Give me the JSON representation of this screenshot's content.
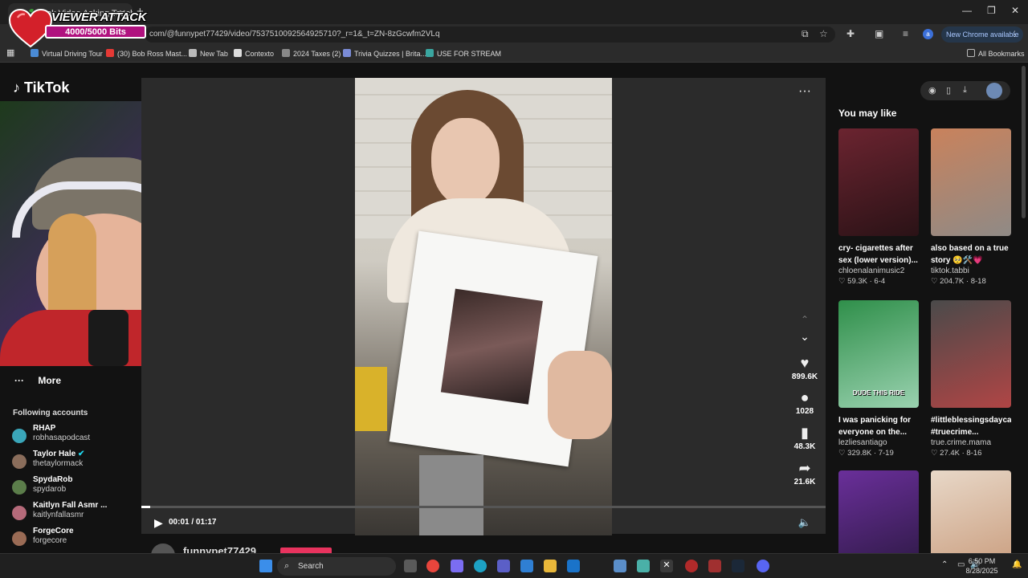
{
  "browser": {
    "tab_title": "ok Video Asking Teach...",
    "url": "com/@funnypet77429/video/7537510092564925710?_r=1&_t=ZN-8zGcwfm2VLq",
    "new_chrome_label": "New Chrome available",
    "profile_letter": "a",
    "bookmarks": [
      {
        "label": "Virtual Driving Tour",
        "color": "#4a8bd6"
      },
      {
        "label": "(30) Bob Ross Mast...",
        "color": "#e53935"
      },
      {
        "label": "New Tab",
        "color": "#bbbbbb"
      },
      {
        "label": "Contexto",
        "color": "#dddddd"
      },
      {
        "label": "2024 Taxes (2)",
        "color": "#888888"
      },
      {
        "label": "Trivia Quizzes | Brita...",
        "color": "#7a8bd6"
      },
      {
        "label": "USE FOR STREAM",
        "color": "#3aa6a0"
      }
    ],
    "all_bookmarks": "All Bookmarks"
  },
  "overlay": {
    "title": "VIEWER ATTACK",
    "bits": "4000/5000 Bits",
    "bits_progress": 0.8
  },
  "tiktok": {
    "logo": "TikTok",
    "more_label": "More",
    "following_title": "Following accounts",
    "accounts": [
      {
        "name": "RHAP",
        "handle": "robhasapodcast",
        "color": "#3aa6b9"
      },
      {
        "name": "Taylor Hale",
        "handle": "thetaylormack",
        "color": "#8a6d5b"
      },
      {
        "name": "SpydaRob",
        "handle": "spydarob",
        "color": "#5b7d4a"
      },
      {
        "name": "Kaitlyn Fall Asmr ...",
        "handle": "kaitlynfallasmr",
        "color": "#b56a7a"
      },
      {
        "name": "ForgeCore",
        "handle": "forgecore",
        "color": "#9a6b55"
      }
    ],
    "actions": {
      "likes": "899.6K",
      "comments": "1028",
      "saves": "48.3K",
      "shares": "21.6K"
    },
    "time": "00:01 / 01:17",
    "progress": 0.013,
    "author": "funnypet77429",
    "you_may_like": "You may like",
    "recommendations": [
      {
        "title": "cry- cigarettes after sex (lower version)...",
        "channel": "chloenalanimusic2",
        "stats": "♡ 59.3K · 6-4",
        "c1": "#6b2430",
        "c2": "#2a1216"
      },
      {
        "title": "also based on a true story 🥺🛠️💗",
        "channel": "tiktok.tabbi",
        "stats": "♡ 204.7K · 8-18",
        "c1": "#c9825c",
        "c2": "#8f8a86"
      },
      {
        "title": "I was panicking for everyone on the...",
        "channel": "lezliesantiago",
        "stats": "♡ 329.8K · 7-19",
        "c1": "#2f8f4a",
        "c2": "#9ad2b0",
        "caption": "DUDE THIS RIDE"
      },
      {
        "title": "#littleblessingsdaycare #truecrime...",
        "channel": "true.crime.mama",
        "stats": "♡ 27.4K · 8-16",
        "c1": "#4a4a4a",
        "c2": "#b04545"
      },
      {
        "title": "",
        "channel": "",
        "stats": "",
        "c1": "#6a2f9a",
        "c2": "#2a1840"
      },
      {
        "title": "",
        "channel": "",
        "stats": "",
        "c1": "#e8d8c8",
        "c2": "#c89a7a"
      }
    ]
  },
  "taskbar": {
    "search_label": "Search",
    "time": "6:50 PM",
    "date": "8/28/2025"
  }
}
